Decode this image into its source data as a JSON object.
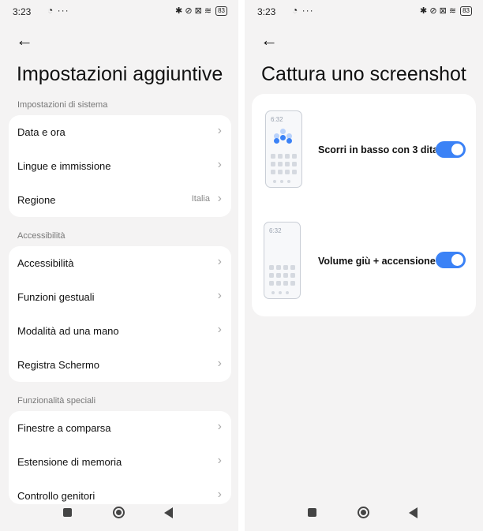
{
  "left": {
    "status": {
      "time": "3:23",
      "extra": "◔ ···",
      "icons": "✱ ⊘ ⊠ ≋",
      "battery": "83"
    },
    "title": "Impostazioni aggiuntive",
    "sections": [
      {
        "header": "Impostazioni di sistema",
        "items": [
          {
            "label": "Data e ora",
            "value": ""
          },
          {
            "label": "Lingue e immissione",
            "value": ""
          },
          {
            "label": "Regione",
            "value": "Italia"
          }
        ]
      },
      {
        "header": "Accessibilità",
        "items": [
          {
            "label": "Accessibilità"
          },
          {
            "label": "Funzioni gestuali"
          },
          {
            "label": "Modalità ad una mano"
          },
          {
            "label": "Registra Schermo"
          }
        ]
      },
      {
        "header": "Funzionalità speciali",
        "items": [
          {
            "label": "Finestre a comparsa"
          },
          {
            "label": "Estensione di memoria"
          },
          {
            "label": "Controllo genitori"
          }
        ]
      }
    ]
  },
  "right": {
    "status": {
      "time": "3:23",
      "extra": "◔ ···",
      "icons": "✱ ⊘ ⊠ ≋",
      "battery": "83"
    },
    "title": "Cattura uno screenshot",
    "options": [
      {
        "label": "Scorri in basso con 3 dita",
        "clock": "6:32",
        "enabled": true
      },
      {
        "label": "Volume giù + accensione",
        "clock": "6:32",
        "enabled": true
      }
    ]
  },
  "accent": "#3b82f6",
  "icons": {
    "back": "arrow-left-icon",
    "chevron": "chevron-right-icon"
  }
}
